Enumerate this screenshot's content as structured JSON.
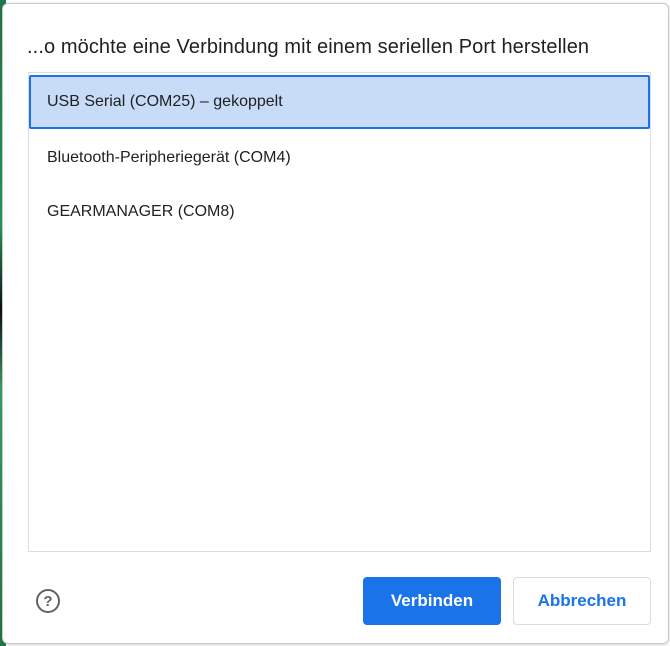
{
  "dialog": {
    "title": "...o möchte eine Verbindung mit einem seriellen Port herstellen",
    "ports": [
      {
        "label": "USB Serial (COM25) – gekoppelt",
        "selected": true
      },
      {
        "label": "Bluetooth-Peripheriegerät (COM4)",
        "selected": false
      },
      {
        "label": "GEARMANAGER (COM8)",
        "selected": false
      }
    ],
    "help_icon": "help-circle-icon",
    "help_glyph": "?",
    "connect_label": "Verbinden",
    "cancel_label": "Abbrechen"
  },
  "colors": {
    "accent": "#1a73e8",
    "selected_bg": "#c8dcf7",
    "border": "#dadce0",
    "text": "#202124"
  }
}
